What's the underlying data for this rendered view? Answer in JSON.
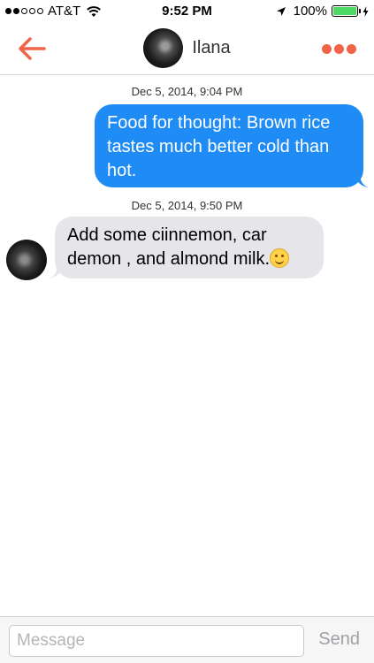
{
  "status_bar": {
    "carrier": "AT&T",
    "time": "9:52 PM",
    "battery": "100%",
    "signal_bars_filled": 2,
    "signal_bars_total": 5,
    "battery_level": 1.0
  },
  "nav": {
    "contact_name": "Ilana",
    "back_icon": "arrow-left-icon",
    "more_icon": "ellipsis-icon",
    "accent_color": "#f06449"
  },
  "messages": [
    {
      "timestamp": "Dec 5, 2014, 9:04 PM",
      "direction": "outgoing",
      "text": "Food for thought: Brown rice tastes much better cold than hot."
    },
    {
      "timestamp": "Dec 5, 2014, 9:50 PM",
      "direction": "incoming",
      "text": "Add some ciinnemon, car demon , and almond milk.",
      "emoji": "smiling-face-icon"
    }
  ],
  "colors": {
    "outgoing_bubble": "#1f8bf5",
    "incoming_bubble": "#e5e5ea"
  },
  "composer": {
    "placeholder": "Message",
    "value": "",
    "send_label": "Send"
  }
}
